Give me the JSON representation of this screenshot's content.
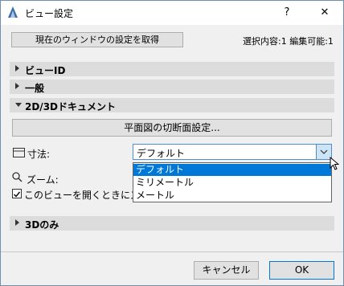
{
  "window": {
    "title": "ビュー設定",
    "help_label": "?",
    "close_label": "✕"
  },
  "toolbar": {
    "get_settings_label": "現在のウィンドウの設定を取得",
    "status": "選択内容:1 編集可能:1"
  },
  "sections": {
    "view_id": "ビューID",
    "general": "一般",
    "doc_2d3d": "2D/3Dドキュメント",
    "only_3d": "3Dのみ"
  },
  "doc_panel": {
    "cut_plane_button": "平面図の切断面設定...",
    "dimension_label": "寸法:",
    "zoom_label": "ズーム:",
    "checkbox_label": "このビューを開くときにズームと",
    "checkbox_checked": true
  },
  "dimension_select": {
    "value": "デフォルト",
    "options": [
      "デフォルト",
      "ミリメートル",
      "メートル"
    ],
    "selected_index": 0
  },
  "footer": {
    "cancel_label": "キャンセル",
    "ok_label": "OK"
  },
  "colors": {
    "accent": "#0078d7",
    "window_bg": "#f0f0f0",
    "section_bg": "#dcdcdc"
  }
}
